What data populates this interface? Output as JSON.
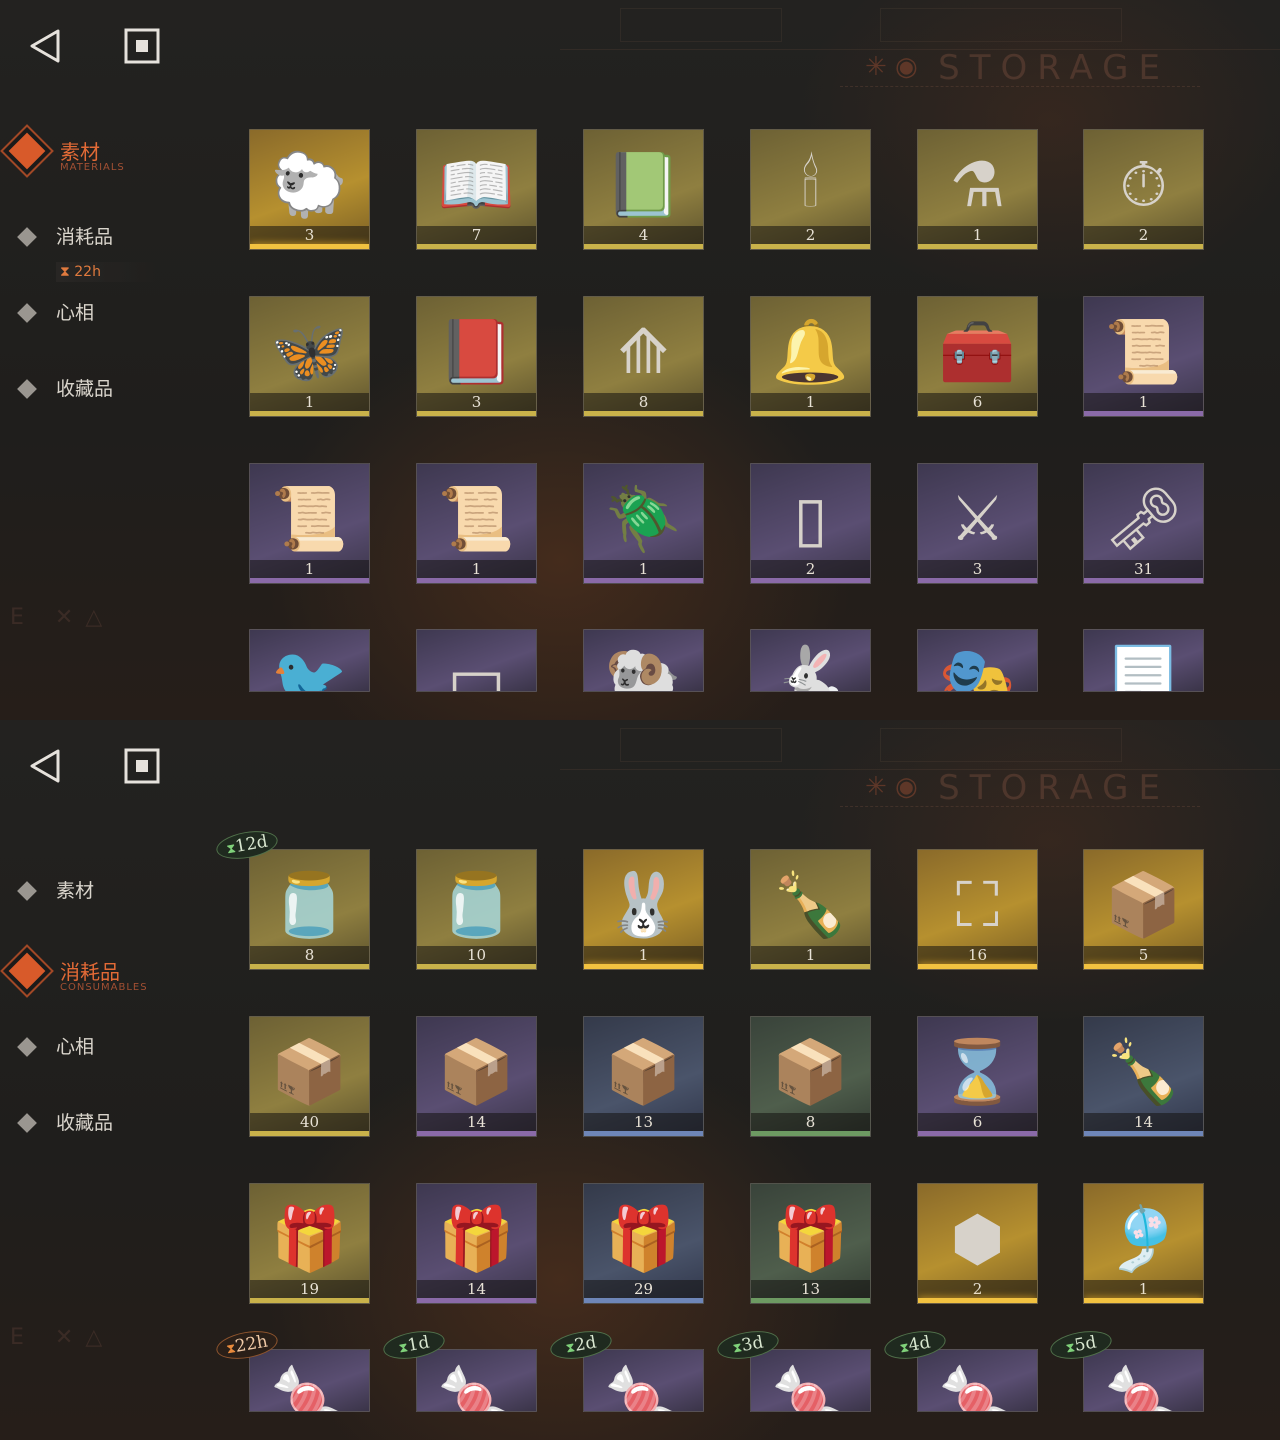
{
  "header": {
    "title": "STORAGE"
  },
  "icons": {
    "back": "back-triangle-icon",
    "home": "square-home-icon"
  },
  "colors": {
    "accent": "#d85a2a",
    "gold": "#f2c240",
    "purple": "#8a6aa8",
    "blue": "#6e86b8",
    "green": "#6d9a62"
  },
  "panel_top": {
    "menu": [
      {
        "label": "素材",
        "en": "MATERIALS",
        "active": true
      },
      {
        "label": "消耗品",
        "en": "",
        "active": false,
        "timer": "22h"
      },
      {
        "label": "心相",
        "en": "",
        "active": false
      },
      {
        "label": "收藏品",
        "en": "",
        "active": false
      }
    ],
    "items": [
      {
        "icon": "sheep-figurine",
        "count": "3",
        "rarity": "gold"
      },
      {
        "icon": "red-gem-book",
        "count": "7",
        "rarity": "yellow"
      },
      {
        "icon": "green-gem-book",
        "count": "4",
        "rarity": "yellow"
      },
      {
        "icon": "ouija-board",
        "count": "2",
        "rarity": "yellow"
      },
      {
        "icon": "purple-potion",
        "count": "1",
        "rarity": "yellow"
      },
      {
        "icon": "brass-clock",
        "count": "2",
        "rarity": "yellow"
      },
      {
        "icon": "glowing-moth",
        "count": "1",
        "rarity": "yellow"
      },
      {
        "icon": "dark-tome",
        "count": "3",
        "rarity": "yellow"
      },
      {
        "icon": "silver-bullets",
        "count": "8",
        "rarity": "yellow"
      },
      {
        "icon": "glass-dome",
        "count": "1",
        "rarity": "yellow"
      },
      {
        "icon": "hand-box",
        "count": "6",
        "rarity": "yellow"
      },
      {
        "icon": "red-scroll",
        "count": "1",
        "rarity": "purple"
      },
      {
        "icon": "green-scroll",
        "count": "1",
        "rarity": "purple"
      },
      {
        "icon": "brown-scroll",
        "count": "1",
        "rarity": "purple"
      },
      {
        "icon": "beetle-pendant",
        "count": "1",
        "rarity": "purple"
      },
      {
        "icon": "glass-case",
        "count": "2",
        "rarity": "purple"
      },
      {
        "icon": "brass-blade",
        "count": "3",
        "rarity": "purple"
      },
      {
        "icon": "winged-key",
        "count": "31",
        "rarity": "purple"
      },
      {
        "icon": "brass-bird",
        "count": "",
        "rarity": "purple"
      },
      {
        "icon": "silver-ingot",
        "count": "",
        "rarity": "purple"
      },
      {
        "icon": "skeleton-ram",
        "count": "",
        "rarity": "purple"
      },
      {
        "icon": "fluffy-bunny",
        "count": "",
        "rarity": "purple"
      },
      {
        "icon": "pumpkin-mask",
        "count": "",
        "rarity": "purple"
      },
      {
        "icon": "parchment",
        "count": "",
        "rarity": "purple"
      }
    ]
  },
  "panel_bottom": {
    "menu": [
      {
        "label": "素材",
        "en": "",
        "active": false
      },
      {
        "label": "消耗品",
        "en": "CONSUMABLES",
        "active": true
      },
      {
        "label": "心相",
        "en": "",
        "active": false
      },
      {
        "label": "收藏品",
        "en": "",
        "active": false
      }
    ],
    "items": [
      {
        "icon": "candy-jar",
        "count": "8",
        "rarity": "yellow",
        "timer": "12d"
      },
      {
        "icon": "candy-jar",
        "count": "10",
        "rarity": "yellow"
      },
      {
        "icon": "rabbit-box",
        "count": "1",
        "rarity": "gold"
      },
      {
        "icon": "message-bottle",
        "count": "1",
        "rarity": "yellow"
      },
      {
        "icon": "rune-chest",
        "count": "16",
        "rarity": "gold"
      },
      {
        "icon": "wooden-crate",
        "count": "5",
        "rarity": "gold"
      },
      {
        "icon": "wooden-crate",
        "count": "40",
        "rarity": "yellow"
      },
      {
        "icon": "wooden-crate",
        "count": "14",
        "rarity": "purple"
      },
      {
        "icon": "wooden-crate",
        "count": "13",
        "rarity": "blue"
      },
      {
        "icon": "wooden-crate",
        "count": "8",
        "rarity": "green"
      },
      {
        "icon": "hourglass",
        "count": "6",
        "rarity": "purple"
      },
      {
        "icon": "message-bottle",
        "count": "14",
        "rarity": "blue"
      },
      {
        "icon": "paper-parcel",
        "count": "19",
        "rarity": "yellow"
      },
      {
        "icon": "paper-parcel",
        "count": "14",
        "rarity": "purple"
      },
      {
        "icon": "paper-parcel",
        "count": "29",
        "rarity": "blue"
      },
      {
        "icon": "paper-parcel",
        "count": "13",
        "rarity": "green"
      },
      {
        "icon": "hex-puzzle",
        "count": "2",
        "rarity": "gold"
      },
      {
        "icon": "ornament-bag",
        "count": "1",
        "rarity": "gold"
      },
      {
        "icon": "candies",
        "count": "",
        "rarity": "purple",
        "timer": "22h",
        "timer_style": "orange"
      },
      {
        "icon": "candies",
        "count": "",
        "rarity": "purple",
        "timer": "1d"
      },
      {
        "icon": "candies",
        "count": "",
        "rarity": "purple",
        "timer": "2d"
      },
      {
        "icon": "candies",
        "count": "",
        "rarity": "purple",
        "timer": "3d"
      },
      {
        "icon": "candies",
        "count": "",
        "rarity": "purple",
        "timer": "4d"
      },
      {
        "icon": "candies",
        "count": "",
        "rarity": "purple",
        "timer": "5d"
      }
    ]
  }
}
